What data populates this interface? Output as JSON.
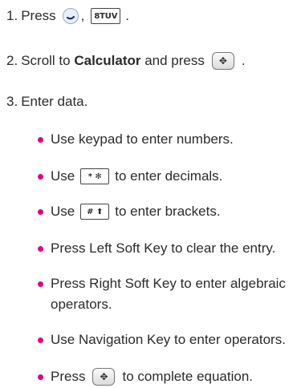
{
  "steps": [
    {
      "number": "1.",
      "text": "Press",
      "keys": [
        "left-soft-key",
        "8tuv-key"
      ],
      "key_labels": [
        "8TUV"
      ],
      "separator": ",",
      "end": "."
    },
    {
      "number": "2.",
      "text_before": "Scroll to",
      "emphasis": "Calculator",
      "text_after": "and press",
      "key": "ok-nav-key",
      "end": "."
    },
    {
      "number": "3.",
      "text": "Enter data."
    }
  ],
  "bullets": [
    {
      "text": "Use keypad to enter numbers."
    },
    {
      "before": "Use",
      "key": "star-key",
      "key_label": "* ✻",
      "after": "to enter decimals."
    },
    {
      "before": "Use",
      "key": "pound-key",
      "key_label": "# ⬆",
      "after": "to enter brackets."
    },
    {
      "text": "Press Left Soft Key to clear the entry."
    },
    {
      "line1": "Press Right Soft Key to enter algebraic",
      "line2": "operators."
    },
    {
      "text": "Use Navigation Key to enter operators."
    },
    {
      "before": "Press",
      "key": "ok-nav-key",
      "after": "to complete equation."
    }
  ],
  "colors": {
    "bullet": "#e4007f",
    "text": "#2b2b2b"
  }
}
